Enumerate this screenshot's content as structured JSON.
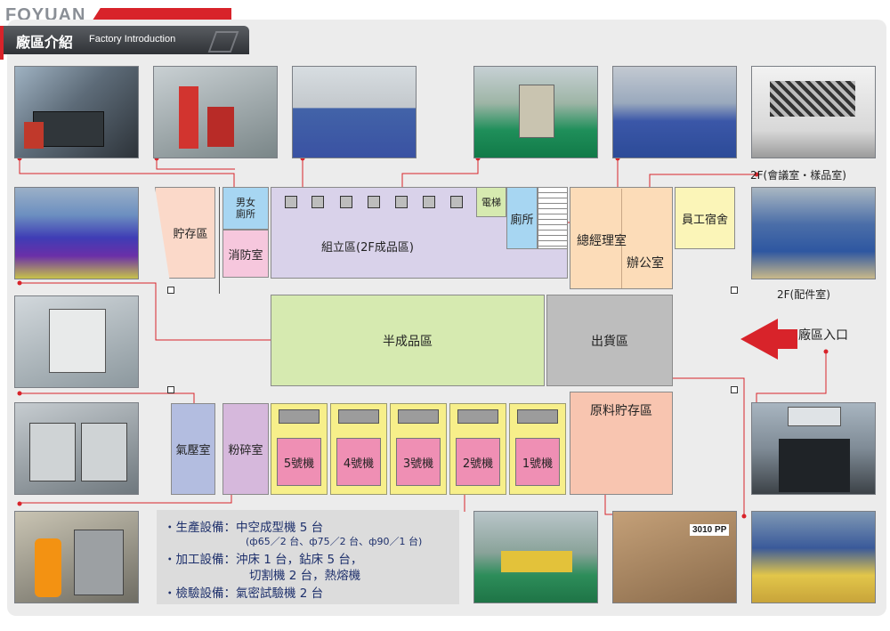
{
  "header": {
    "logo_text": "FOYUAN",
    "title_zh": "廠區介紹",
    "title_en": "Factory Introduction",
    "accent_color": "#d8232a"
  },
  "areas": {
    "storage": "貯存區",
    "mens_toilet": "男女\n廁所",
    "fire_room": "消防室",
    "assembly": "組立區(2F成品區)",
    "elevator": "電梯",
    "toilet": "廁所",
    "gm_office": "總經理室",
    "office": "辦公室",
    "dormitory": "員工宿舍",
    "semi_finished": "半成品區",
    "shipping": "出貨區",
    "air_compressor": "氣壓室",
    "crushing": "粉碎室",
    "raw_material": "原料貯存區",
    "entrance": "廠區入口"
  },
  "machines": [
    "5號機",
    "4號機",
    "3號機",
    "2號機",
    "1號機"
  ],
  "captions": {
    "meeting": "2F(會議室・樣品室)",
    "parts": "2F(配件室)",
    "sign_text": "3010 PP"
  },
  "equipment": {
    "line1": "・生產設備：中空成型機 5 台",
    "line1_sub": "(ф65／2 台、ф75／2 台、ф90／1 台)",
    "line2": "・加工設備：沖床 1 台，鉆床 5 台，",
    "line2b": "切割機 2 台，熱熔機",
    "line3": "・檢驗設備：氣密試驗機 2 台"
  },
  "colors": {
    "storage": "#fbd9c9",
    "assembly": "#d9d2ea",
    "toilet_blue": "#a7d6f2",
    "fire": "#f6c7dd",
    "office": "#fcdcb8",
    "dormitory": "#fbf5b8",
    "semi": "#d6eab0",
    "shipping": "#bdbdbd",
    "air": "#b3bde0",
    "crushing": "#d6b8dc",
    "raw": "#f8c5b0",
    "machine": "#f7ef8a",
    "machine_pink": "#ef8fb4"
  }
}
